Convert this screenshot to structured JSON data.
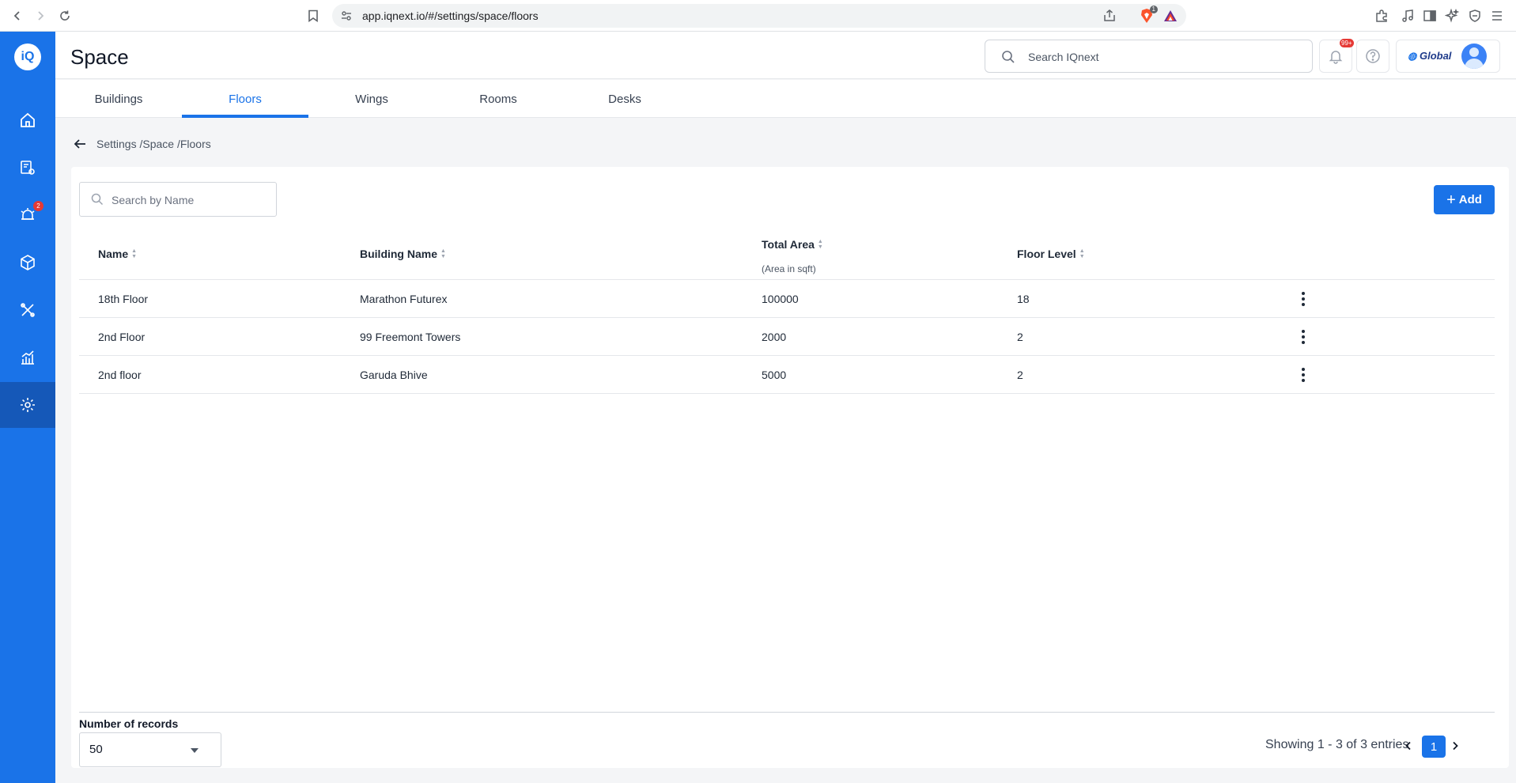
{
  "browser": {
    "url": "app.iqnext.io/#/settings/space/floors",
    "brave_badge": "1"
  },
  "sidebar": {
    "logo_text": "iQ",
    "items": [
      {
        "icon": "home-icon"
      },
      {
        "icon": "asset-settings-icon"
      },
      {
        "icon": "alerts-icon",
        "badge": "2"
      },
      {
        "icon": "cube-icon"
      },
      {
        "icon": "tools-icon"
      },
      {
        "icon": "analytics-icon"
      },
      {
        "icon": "gear-icon",
        "active": true
      }
    ]
  },
  "header": {
    "title": "Space",
    "search_placeholder": "Search IQnext",
    "notification_badge": "99+",
    "brand_name": "Global"
  },
  "tabs": [
    {
      "label": "Buildings"
    },
    {
      "label": "Floors",
      "active": true
    },
    {
      "label": "Wings"
    },
    {
      "label": "Rooms"
    },
    {
      "label": "Desks"
    }
  ],
  "breadcrumb": {
    "text": "Settings /Space /Floors"
  },
  "table": {
    "search_placeholder": "Search by Name",
    "add_label": "Add",
    "columns": {
      "name": "Name",
      "building": "Building Name",
      "area": "Total Area",
      "area_sub": "(Area in sqft)",
      "level": "Floor Level"
    },
    "rows": [
      {
        "name": "18th Floor",
        "building": "Marathon Futurex",
        "area": "100000",
        "level": "18"
      },
      {
        "name": "2nd Floor",
        "building": "99 Freemont Towers",
        "area": "2000",
        "level": "2"
      },
      {
        "name": "2nd floor",
        "building": "Garuda Bhive",
        "area": "5000",
        "level": "2"
      }
    ]
  },
  "footer": {
    "records_label": "Number of records",
    "records_value": "50",
    "showing": "Showing 1 - 3 of 3 entries",
    "current_page": "1"
  },
  "colors": {
    "accent": "#1a73e8",
    "sidebar": "#1a73e8",
    "badge": "#e53935"
  }
}
